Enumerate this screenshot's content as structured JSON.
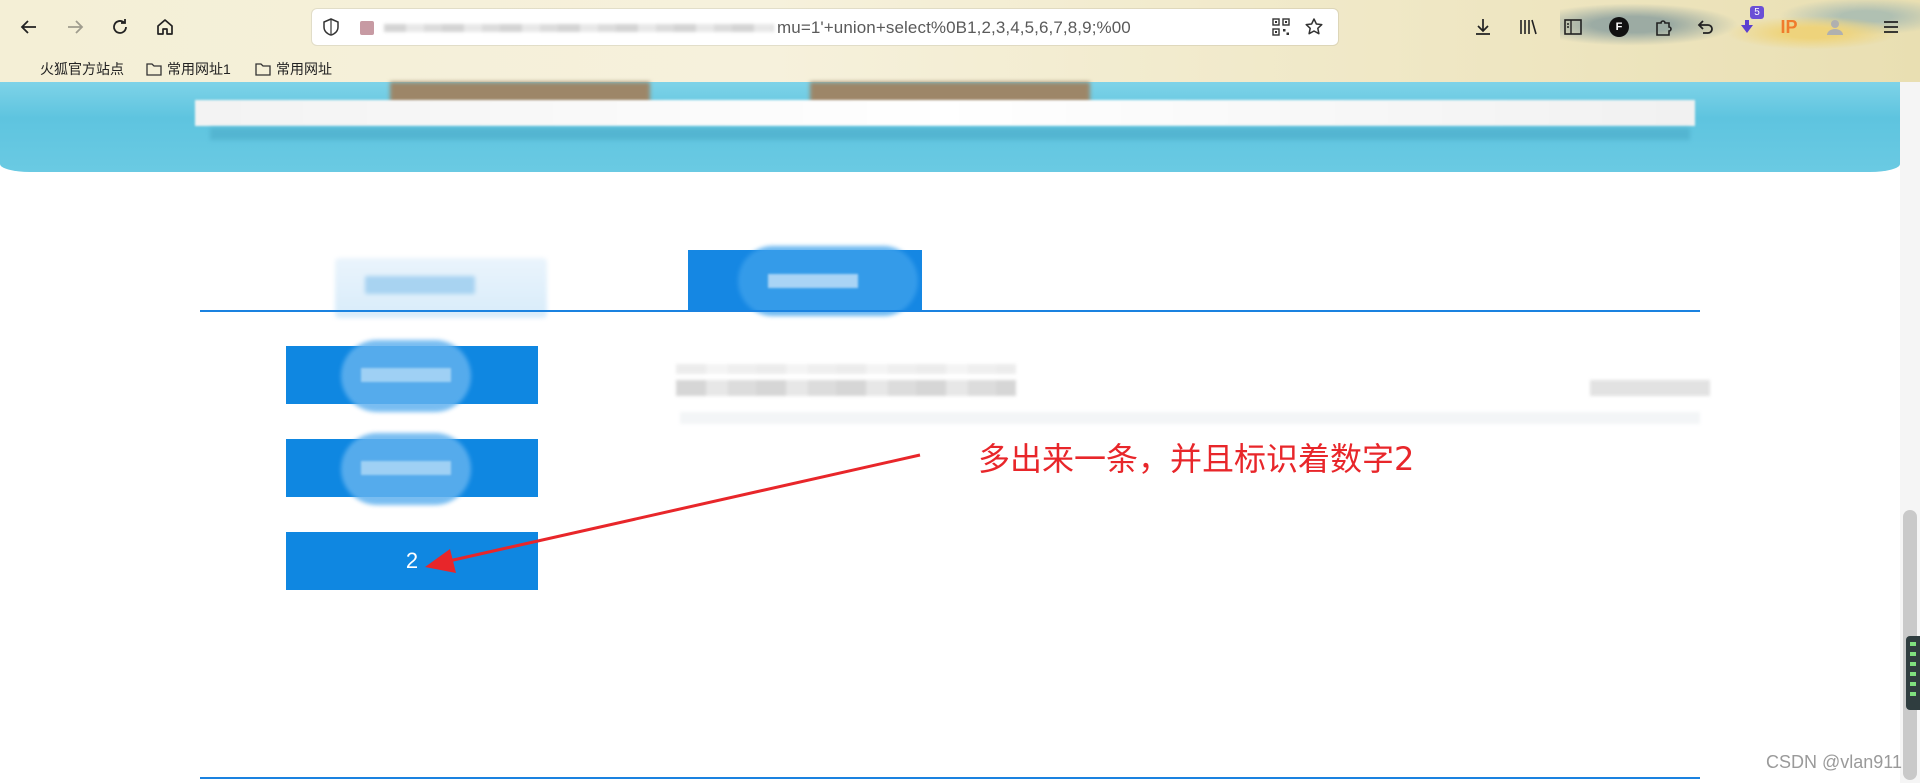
{
  "browser": {
    "url_visible_text": "mu=1'+union+select%0B1,2,3,4,5,6,7,8,9;%00",
    "ext_badge_count": "5",
    "ip_label": "IP",
    "f_badge": "F",
    "bookmarks": [
      {
        "label": "火狐官方站点"
      },
      {
        "label": "常用网址1"
      },
      {
        "label": "常用网址"
      }
    ],
    "icons": [
      "back-icon",
      "forward-icon",
      "reload-icon",
      "home-icon",
      "shield-icon",
      "qr-code-icon",
      "star-icon",
      "download-icon",
      "library-icon",
      "sidebar-icon",
      "extension-f-icon",
      "puzzle-icon",
      "undo-icon",
      "download-ext-icon",
      "ip-icon",
      "avatar-icon",
      "menu-icon"
    ]
  },
  "page": {
    "side_buttons": [
      {
        "label": ""
      },
      {
        "label": ""
      },
      {
        "label": "2"
      }
    ],
    "annotation": "多出来一条，并且标识着数字2",
    "accent_color": "#0f87e1",
    "annotation_color": "#e8262a"
  },
  "watermark": "CSDN @vlan911"
}
